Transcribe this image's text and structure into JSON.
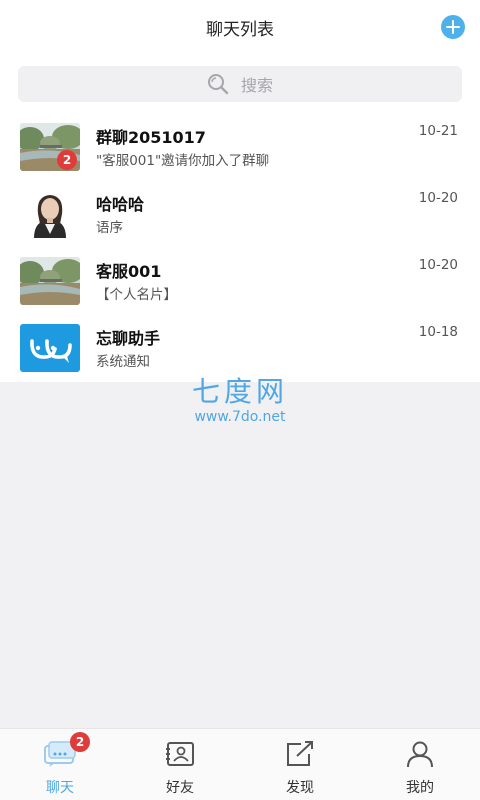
{
  "header": {
    "title": "聊天列表",
    "add_icon": "plus-circle-icon"
  },
  "search": {
    "placeholder": "搜索",
    "icon": "search-icon"
  },
  "chats": [
    {
      "name": "群聊2051017",
      "preview": "\"客服001\"邀请你加入了群聊",
      "date": "10-21",
      "badge": "2",
      "avatar": "landscape-photo"
    },
    {
      "name": "哈哈哈",
      "preview": "语序",
      "date": "10-20",
      "avatar": "portrait-photo"
    },
    {
      "name": "客服001",
      "preview": "【个人名片】",
      "date": "10-20",
      "avatar": "landscape-photo"
    },
    {
      "name": "忘聊助手",
      "preview": "系统通知",
      "date": "10-18",
      "avatar": "assistant-logo"
    }
  ],
  "watermark": {
    "brand": "七度网",
    "url": "www.7do.net"
  },
  "tabbar": {
    "items": [
      {
        "label": "聊天",
        "icon": "chat-icon",
        "badge": "2",
        "active": true
      },
      {
        "label": "好友",
        "icon": "contacts-icon"
      },
      {
        "label": "发现",
        "icon": "discover-icon"
      },
      {
        "label": "我的",
        "icon": "profile-icon"
      }
    ]
  },
  "colors": {
    "accent": "#4fa7e5",
    "badge": "#e03b3b",
    "background": "#f1f1f4"
  }
}
